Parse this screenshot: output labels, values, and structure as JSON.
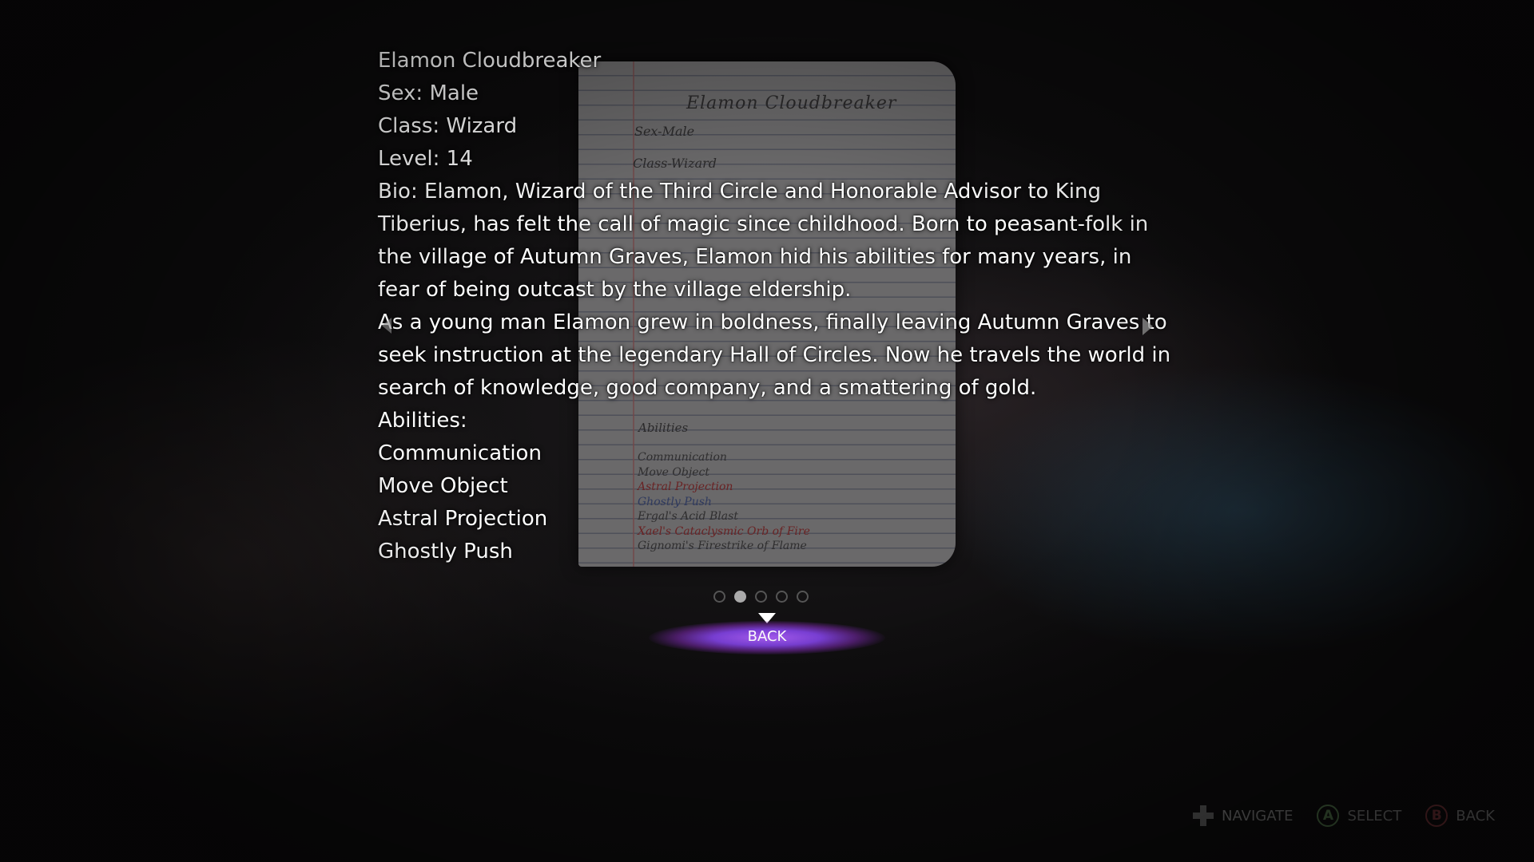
{
  "character": {
    "name": "Elamon Cloudbreaker",
    "sex": "Sex: Male",
    "class": "Class: Wizard",
    "level": "Level: 14",
    "bio_1": "Bio: Elamon, Wizard of the Third Circle and Honorable Advisor to King Tiberius, has felt the call of magic since childhood. Born to peasant-folk in the village of Autumn Graves, Elamon hid his abilities for many years, in fear of being outcast by the village eldership.",
    "bio_2": "As a young man Elamon grew in boldness, finally leaving Autumn Graves to seek instruction at the legendary Hall of Circles. Now he travels the world in search of knowledge, good company, and a smattering of gold.",
    "abilities_heading": "Abilities:",
    "abilities": [
      "Communication",
      "Move Object",
      "Astral Projection",
      "Ghostly Push"
    ]
  },
  "notebook": {
    "title": "Elamon Cloudbreaker",
    "sex": "Sex-Male",
    "class": "Class-Wizard",
    "abilities_heading": "Abilities",
    "abilities": [
      {
        "text": "Communication",
        "color": "#3a3a3a"
      },
      {
        "text": "Move Object",
        "color": "#3a3a3a"
      },
      {
        "text": "Astral Projection",
        "color": "#8a2a2a"
      },
      {
        "text": "Ghostly Push",
        "color": "#3a4a7a"
      },
      {
        "text": "Ergal's Acid Blast",
        "color": "#3a3a3a"
      },
      {
        "text": "Xael's Cataclysmic Orb of Fire",
        "color": "#8a2a2a"
      },
      {
        "text": "Gignomi's Firestrike of Flame",
        "color": "#3a3a3a"
      }
    ]
  },
  "pagination": {
    "total": 5,
    "active_index": 1
  },
  "back_button": {
    "label": "BACK"
  },
  "hints": {
    "navigate": "NAVIGATE",
    "select_glyph": "A",
    "select": "SELECT",
    "back_glyph": "B",
    "back": "BACK"
  },
  "colors": {
    "accent_purple": "#a75cf0",
    "button_a": "#4b6b45",
    "button_b": "#6b2f33"
  },
  "icons": {
    "prev": "chevron-left-icon",
    "next": "chevron-right-icon",
    "navigate": "dpad-icon",
    "select": "a-button-icon",
    "back": "b-button-icon"
  }
}
